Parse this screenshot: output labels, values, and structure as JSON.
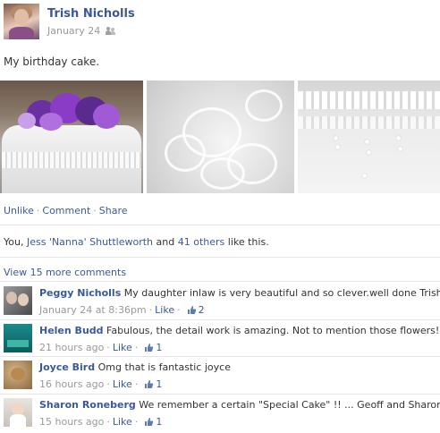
{
  "post": {
    "author": "Trish Nicholls",
    "date": "January 24",
    "message": "My birthday cake."
  },
  "actions": {
    "unlike": "Unlike",
    "comment": "Comment",
    "share": "Share",
    "separator": "·"
  },
  "likes": {
    "prefix": "You, ",
    "friend": "Jess 'Nanna' Shuttleworth",
    "middle": " and ",
    "others": "41 others",
    "suffix": " like this."
  },
  "view_more": "View 15 more comments",
  "comments": [
    {
      "name": "Peggy Nicholls",
      "text": "My daughter inlaw is very beautiful and so clever.well done Trish.",
      "time": "January 24 at 8:36pm",
      "like_label": "Like",
      "likes": "2"
    },
    {
      "name": "Helen Budd",
      "text": "Fabulous, the detail work is amazing. Not to mention those flowers!",
      "time": "21 hours ago",
      "like_label": "Like",
      "likes": "1"
    },
    {
      "name": "Joyce Bird",
      "text": "Omg that is fantastic joyce",
      "time": "16 hours ago",
      "like_label": "Like",
      "likes": "1"
    },
    {
      "name": "Sharon Roneberg",
      "text": "We remember a certain \"Special Cake\" !! ... Geoff and Sharon",
      "time": "15 hours ago",
      "like_label": "Like",
      "likes": "1"
    }
  ],
  "colors": {
    "link": "#3b5998",
    "muted": "#999999",
    "text": "#333333"
  },
  "icons": {
    "audience": "friends-icon",
    "like": "thumbs-up-icon"
  }
}
